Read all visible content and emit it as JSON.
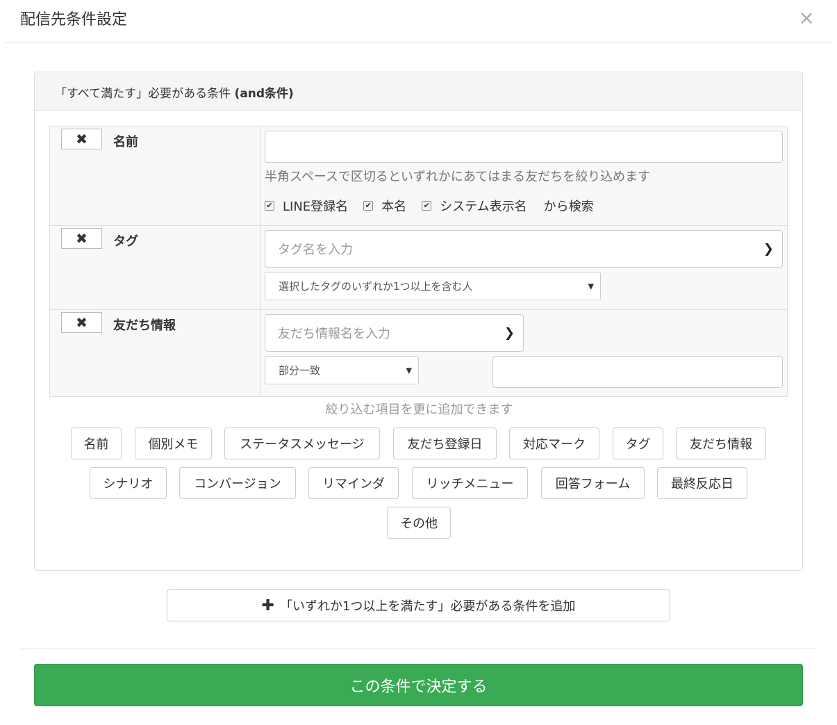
{
  "modal": {
    "title": "配信先条件設定",
    "close_label": "×"
  },
  "and_panel": {
    "heading_prefix": "「すべて満たす」必要がある条件 ",
    "heading_bold": "(and条件)",
    "conditions": {
      "name": {
        "remove_label": "✖",
        "label": "名前",
        "input_value": "",
        "help": "半角スペースで区切るといずれかにあてはまる友だちを絞り込めます",
        "checks": [
          {
            "label": "LINE登録名",
            "checked": true
          },
          {
            "label": "本名",
            "checked": true
          },
          {
            "label": "システム表示名",
            "checked": true
          }
        ],
        "check_suffix": "から検索"
      },
      "tag": {
        "remove_label": "✖",
        "label": "タグ",
        "placeholder": "タグ名を入力",
        "match_select": "選択したタグのいずれか1つ以上を含む人"
      },
      "friend_info": {
        "remove_label": "✖",
        "label": "友だち情報",
        "placeholder": "友だち情報名を入力",
        "match_select": "部分一致",
        "value": ""
      }
    },
    "add_hint": "絞り込む項目を更に追加できます",
    "chips": [
      "名前",
      "個別メモ",
      "ステータスメッセージ",
      "友だち登録日",
      "対応マーク",
      "タグ",
      "友だち情報",
      "シナリオ",
      "コンバージョン",
      "リマインダ",
      "リッチメニュー",
      "回答フォーム",
      "最終反応日",
      "その他"
    ]
  },
  "add_or_button": {
    "icon": "plus-icon",
    "label": "「いずれか1つ以上を満たす」必要がある条件を追加"
  },
  "submit": {
    "label": "この条件で決定する"
  },
  "colors": {
    "submit_bg": "#3aaa55",
    "panel_heading_bg": "#f5f5f5"
  }
}
